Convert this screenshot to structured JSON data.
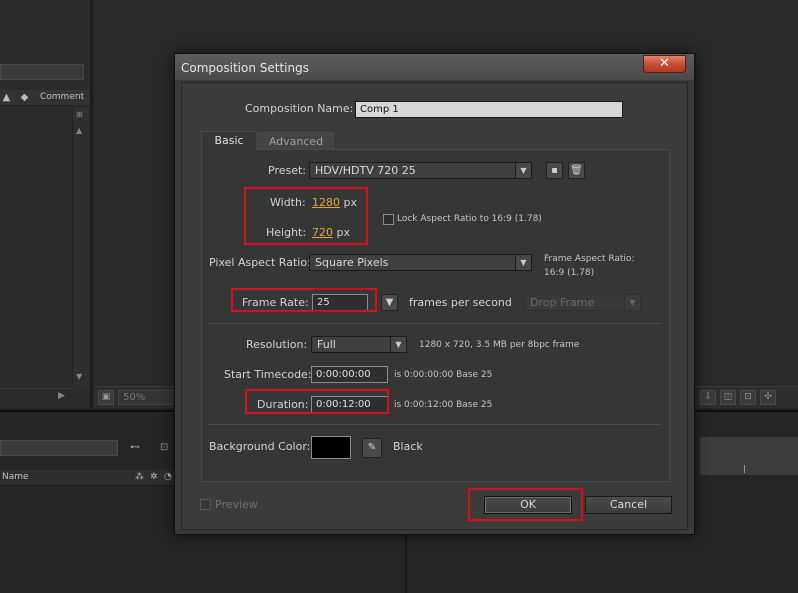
{
  "background": {
    "project_panel": {
      "column_comment": "Comment"
    },
    "viewer": {
      "zoom": "50%"
    },
    "timeline": {
      "column_name": "Name"
    }
  },
  "dialog": {
    "title": "Composition Settings",
    "close_glyph": "✕",
    "comp_name_label": "Composition Name:",
    "comp_name_value": "Comp 1",
    "tabs": [
      "Basic",
      "Advanced"
    ],
    "preset_label": "Preset:",
    "preset_value": "HDV/HDTV 720 25",
    "width_label": "Width:",
    "width_value": "1280",
    "width_unit": "px",
    "height_label": "Height:",
    "height_value": "720",
    "height_unit": "px",
    "lock_aspect_label": "Lock Aspect Ratio to 16:9 (1.78)",
    "pixel_aspect_label": "Pixel Aspect Ratio:",
    "pixel_aspect_value": "Square Pixels",
    "frame_aspect_label": "Frame Aspect Ratio:",
    "frame_aspect_value": "16:9 (1.78)",
    "frame_rate_label": "Frame Rate:",
    "frame_rate_value": "25",
    "frame_rate_unit": "frames per second",
    "drop_frame_value": "Drop Frame",
    "resolution_label": "Resolution:",
    "resolution_value": "Full",
    "resolution_info": "1280 x 720, 3.5 MB per 8bpc frame",
    "start_timecode_label": "Start Timecode:",
    "start_timecode_value": "0:00:00:00",
    "start_timecode_info": "is 0:00:00:00  Base 25",
    "duration_label": "Duration:",
    "duration_value": "0:00:12:00",
    "duration_info": "is 0:00:12:00  Base 25",
    "bg_color_label": "Background Color:",
    "bg_color_name": "Black",
    "bg_color_hex": "#000000",
    "preview_label": "Preview",
    "ok_label": "OK",
    "cancel_label": "Cancel",
    "highlight_color": "#d6101b",
    "link_color": "#e0a63a"
  }
}
